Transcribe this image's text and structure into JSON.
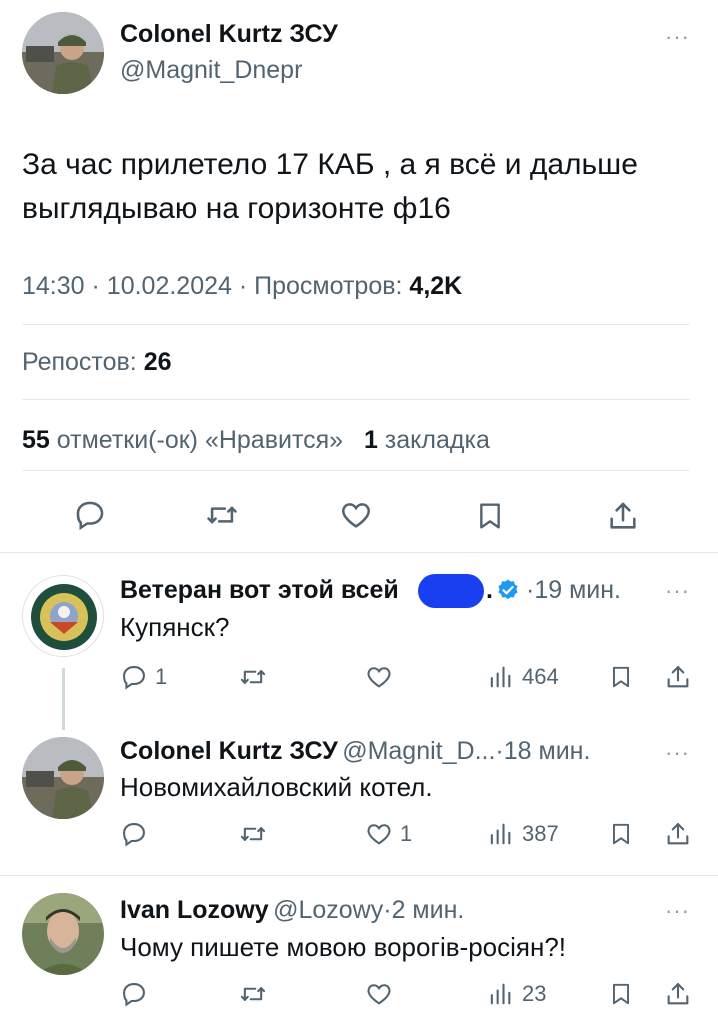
{
  "main_tweet": {
    "author_name": "Colonel Kurtz ЗСУ",
    "author_handle": "@Magnit_Dnepr",
    "text_line1": "За час прилетело 17 КАБ , а я всё и  дальше",
    "text_line2": "выглядываю на горизонте ф16",
    "time": "14:30",
    "date": "10.02.2024",
    "views_label": "Просмотров:",
    "views_value": "4,2K",
    "reposts_label": "Репостов:",
    "reposts_value": "26",
    "likes_value": "55",
    "likes_label": "отметки(-ок) «Нравится»",
    "bookmarks_value": "1",
    "bookmarks_label": "закладка"
  },
  "replies": [
    {
      "author_name": "Ветеран вот этой всей",
      "verified": true,
      "time": "19 мин.",
      "text": "Купянск?",
      "reply_count": "1",
      "like_count": "",
      "view_count": "464"
    },
    {
      "author_name": "Colonel Kurtz ЗСУ",
      "author_handle": "@Magnit_D...",
      "time": "18 мин.",
      "text": "Новомихайловский котел.",
      "reply_count": "",
      "like_count": "1",
      "view_count": "387"
    },
    {
      "author_name": "Ivan Lozowy",
      "author_handle": "@Lozowy",
      "time": "2 мин.",
      "text": "Чому пишете мовою ворогів-росіян?!",
      "reply_count": "",
      "like_count": "",
      "view_count": "23"
    }
  ],
  "common": {
    "separator": "·",
    "more": "···"
  },
  "colors": {
    "text": "#0f1419",
    "muted": "#536471",
    "divider": "#e7e9ea",
    "verified_blue": "#1d9bf0",
    "redaction_blue": "#1a3ff0"
  }
}
